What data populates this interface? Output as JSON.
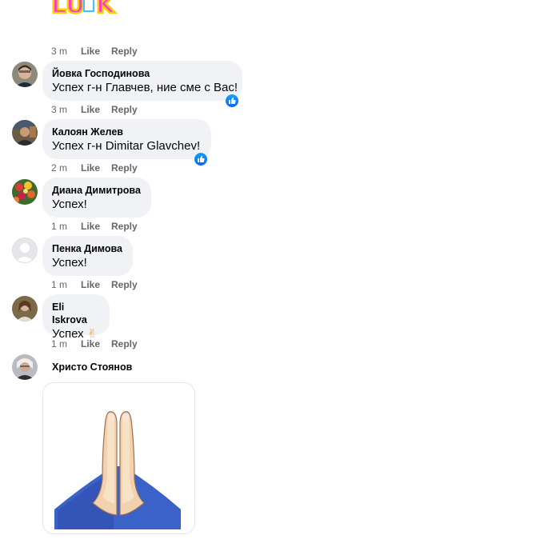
{
  "comments_prev": {
    "time": "3 m",
    "like": "Like",
    "reply": "Reply",
    "sticker_label": "LUCK"
  },
  "comments": [
    {
      "author": "Йовка Господинова",
      "text": "Успех г-н Главчев, ние сме с Вас!",
      "time": "3 m",
      "like": "Like",
      "reply": "Reply",
      "liked": true
    },
    {
      "author": "Калоян Желев",
      "text_prefix": "Успех г-н ",
      "mention": "Dimitar Glavchev",
      "text_suffix": "!",
      "time": "2 m",
      "like": "Like",
      "reply": "Reply",
      "liked": true
    },
    {
      "author": "Диана Димитрова",
      "text": "Успех!",
      "time": "1 m",
      "like": "Like",
      "reply": "Reply",
      "liked": false
    },
    {
      "author": "Пенка Димова",
      "text": "Успех!",
      "time": "1 m",
      "like": "Like",
      "reply": "Reply",
      "liked": false
    },
    {
      "author": "Eli Iskrova",
      "text": "Успех",
      "emoji": "✌",
      "time": "1 m",
      "like": "Like",
      "reply": "Reply",
      "liked": false
    },
    {
      "author": "Христо Стоянов",
      "sticker": "praying-hands"
    }
  ],
  "colors": {
    "bubble": "#f0f2f5",
    "meta": "#65676b",
    "like_blue": "#0866ff",
    "sleeve_blue": "#3a62c8"
  }
}
